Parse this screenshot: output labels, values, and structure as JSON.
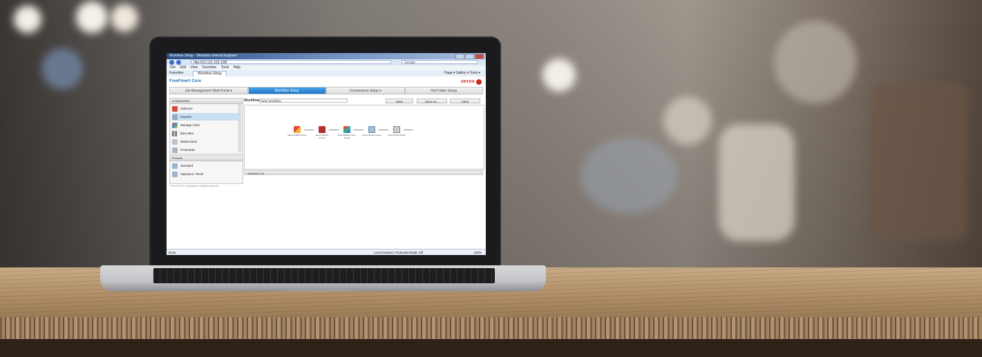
{
  "browser": {
    "title": "Workflow Setup - Windows Internet Explorer",
    "address": "http://13.121.163.128/",
    "search_placeholder": "Google",
    "menu": [
      "File",
      "Edit",
      "View",
      "Favorites",
      "Tools",
      "Help"
    ],
    "favorites_label": "Favorites",
    "tab_label": "Workflow Setup",
    "toolbar_right": "Page ▾  Safety ▾  Tools ▾"
  },
  "app": {
    "brand": "FreeFlow® Core",
    "xerox_logo": "xerox",
    "tabs": [
      "Job Management Web Portal ▾",
      "Workflow Setup",
      "Connections Setup ▾",
      "Hot Folder Setup"
    ],
    "active_tab": 1,
    "components_header": "Components",
    "components": [
      "Optimize",
      "Imposer",
      "Manage Color",
      "Barcodes",
      "Watermarks",
      "Postmarks"
    ],
    "selected_component": 1,
    "presets_header": "Presets",
    "presets": [
      "Standard",
      "Signature / Book"
    ],
    "copyright": "© 2014 Xerox Corporation. All rights reserved.",
    "workflow_label": "Workflow:",
    "workflow_name": "New Workflow",
    "buttons": [
      "Save",
      "Save As...",
      "Clear"
    ],
    "nodes": [
      "New Preflight Preset",
      "New Optimize Preset",
      "New Manage Color Preset",
      "New Imposer Preset",
      "New Output Preset"
    ],
    "workflow_list_label": "Workflow List"
  },
  "status": {
    "left": "Done",
    "middle": "Local intranet | Protected Mode: Off",
    "zoom": "100%"
  },
  "colors": {
    "brand_blue": "#1a6fb5",
    "xerox_red": "#d3261f",
    "active_tab": "#1d78c8"
  }
}
